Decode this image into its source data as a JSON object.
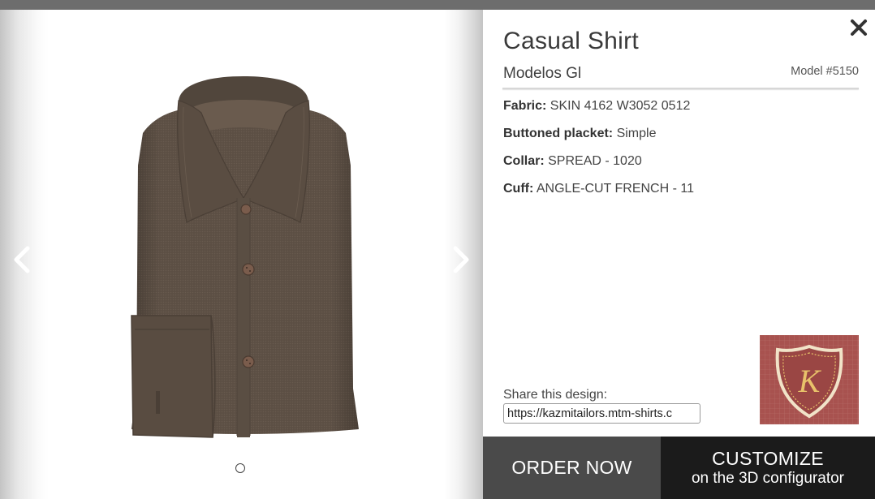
{
  "product": {
    "title": "Casual Shirt",
    "subtitle": "Modelos Gl",
    "model": "Model #5150"
  },
  "specs": [
    {
      "label": "Fabric:",
      "value": "SKIN 4162 W3052 0512"
    },
    {
      "label": "Buttoned placket:",
      "value": "Simple"
    },
    {
      "label": "Collar:",
      "value": "SPREAD - 1020"
    },
    {
      "label": "Cuff:",
      "value": "ANGLE-CUT FRENCH - 11"
    }
  ],
  "share": {
    "label": "Share this design:",
    "url": "https://kazmitailors.mtm-shirts.c"
  },
  "actions": {
    "order": "ORDER NOW",
    "customize_line1": "CUSTOMIZE",
    "customize_line2": "on the 3D configurator"
  },
  "brand": {
    "logo_letter": "K"
  },
  "gallery": {
    "image_count": 1,
    "current": 1,
    "shirt_color": "#5e5146"
  },
  "colors": {
    "order_bg": "#4a4a4a",
    "customize_bg": "#1b1b1b",
    "logo_bg": "#a8524f",
    "logo_gold": "#e8c26a"
  },
  "icons": {
    "close": "close-icon",
    "prev": "chevron-left-icon",
    "next": "chevron-right-icon"
  }
}
